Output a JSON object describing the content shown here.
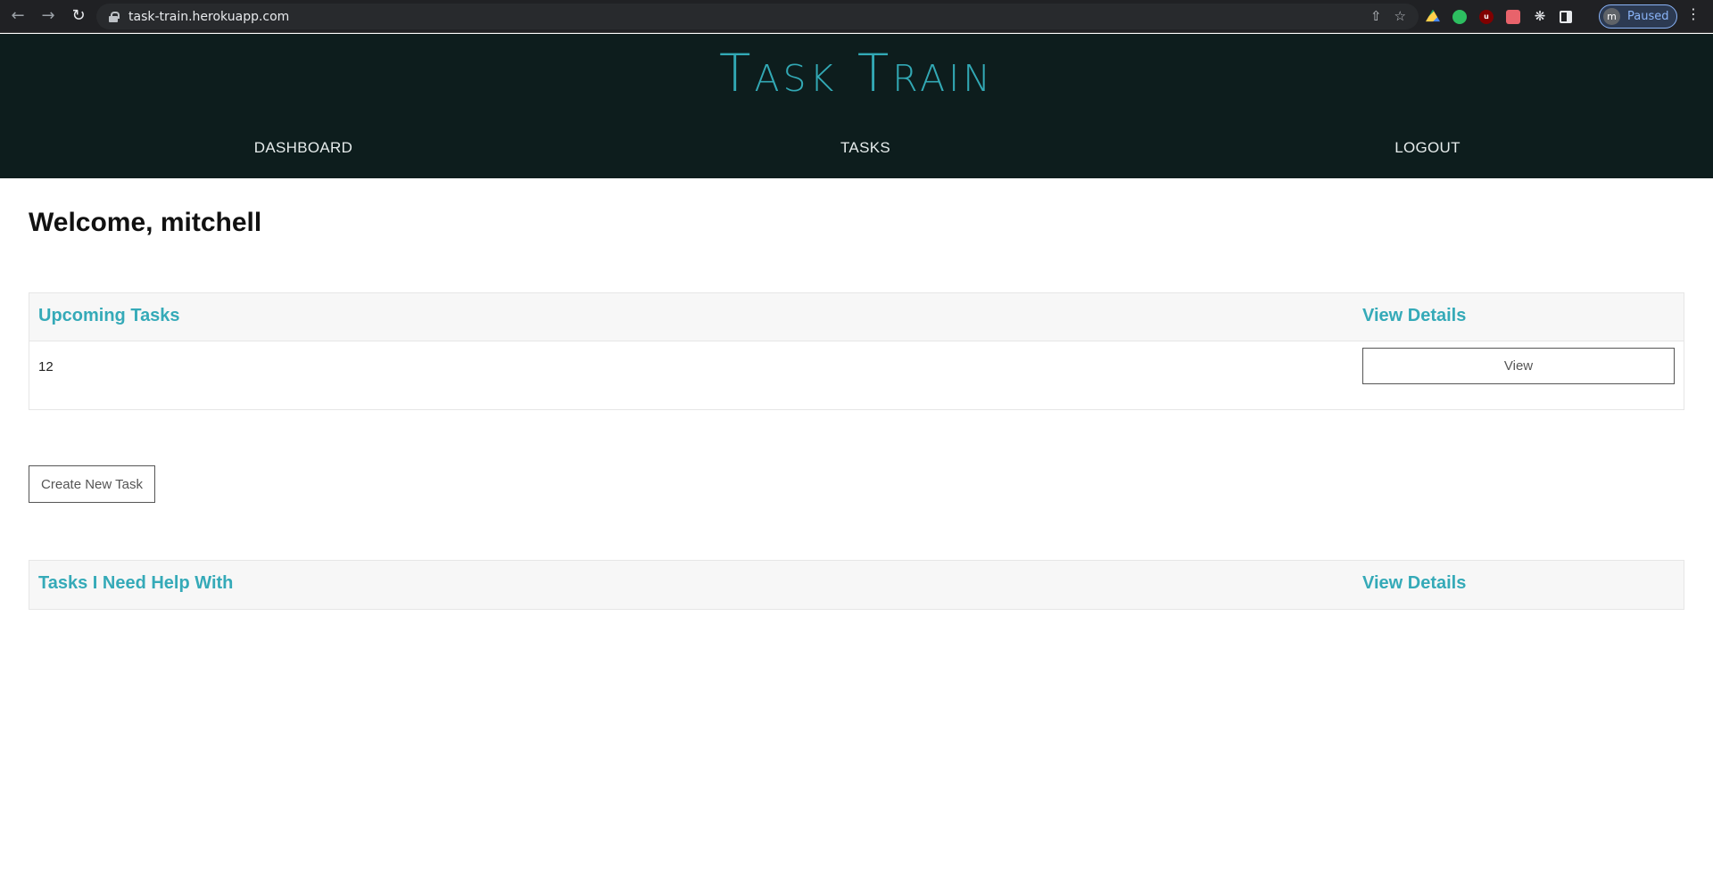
{
  "browser": {
    "url": "task-train.herokuapp.com",
    "profile_initial": "m",
    "profile_status": "Paused"
  },
  "site": {
    "brand": "Task Train",
    "nav": [
      {
        "label": "DASHBOARD"
      },
      {
        "label": "TASKS"
      },
      {
        "label": "LOGOUT"
      }
    ]
  },
  "dashboard": {
    "welcome": "Welcome, mitchell",
    "upcoming": {
      "heading": "Upcoming Tasks",
      "details_heading": "View Details",
      "rows": [
        {
          "value": "12",
          "button": "View"
        }
      ]
    },
    "create_button": "Create New Task",
    "help": {
      "heading": "Tasks I Need Help With",
      "details_heading": "View Details"
    }
  },
  "colors": {
    "accent": "#35aab8",
    "header_bg": "#0d1d1d"
  }
}
